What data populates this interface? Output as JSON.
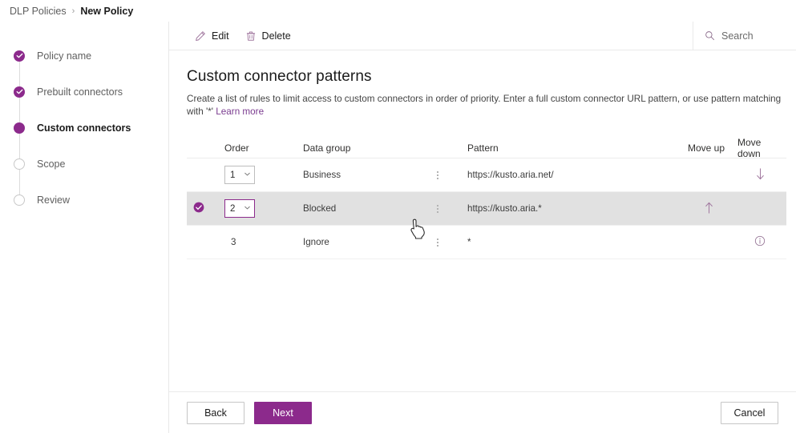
{
  "breadcrumb": {
    "parent": "DLP Policies",
    "separator": "›",
    "current": "New Policy"
  },
  "sidebar": {
    "steps": [
      {
        "label": "Policy name",
        "state": "done"
      },
      {
        "label": "Prebuilt connectors",
        "state": "done"
      },
      {
        "label": "Custom connectors",
        "state": "current"
      },
      {
        "label": "Scope",
        "state": "todo"
      },
      {
        "label": "Review",
        "state": "todo"
      }
    ]
  },
  "toolbar": {
    "edit_label": "Edit",
    "delete_label": "Delete"
  },
  "search": {
    "placeholder": "Search",
    "value": ""
  },
  "page": {
    "title": "Custom connector patterns",
    "description": "Create a list of rules to limit access to custom connectors in order of priority. Enter a full custom connector URL pattern, or use pattern matching with '*' ",
    "learn_more": "Learn more"
  },
  "table": {
    "headers": {
      "order": "Order",
      "data_group": "Data group",
      "pattern": "Pattern",
      "move_up": "Move up",
      "move_down": "Move down"
    },
    "rows": [
      {
        "selected": false,
        "order": "1",
        "order_editable": true,
        "data_group": "Business",
        "pattern": "https://kusto.aria.net/",
        "move_up": "",
        "move_down": "arrow-down-icon",
        "info": false
      },
      {
        "selected": true,
        "order": "2",
        "order_editable": true,
        "data_group": "Blocked",
        "pattern": "https://kusto.aria.*",
        "move_up": "arrow-up-icon",
        "move_down": "",
        "info": false
      },
      {
        "selected": false,
        "order": "3",
        "order_editable": false,
        "data_group": "Ignore",
        "pattern": "*",
        "move_up": "",
        "move_down": "",
        "info": true
      }
    ]
  },
  "footer": {
    "back_label": "Back",
    "next_label": "Next",
    "cancel_label": "Cancel"
  },
  "colors": {
    "accent": "#8c2a8c",
    "accent_dark": "#742774",
    "selected_row": "#e1e1e1",
    "icon_purple": "#a1789f"
  }
}
